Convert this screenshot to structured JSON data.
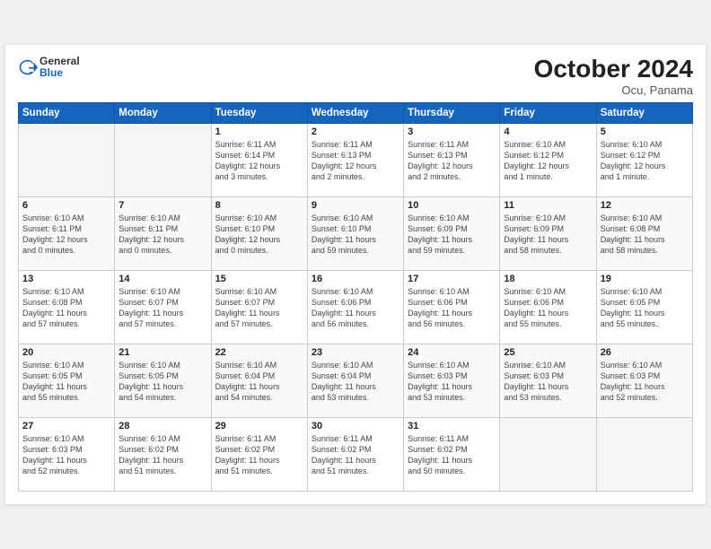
{
  "header": {
    "logo_general": "General",
    "logo_blue": "Blue",
    "month_title": "October 2024",
    "location": "Ocu, Panama"
  },
  "columns": [
    "Sunday",
    "Monday",
    "Tuesday",
    "Wednesday",
    "Thursday",
    "Friday",
    "Saturday"
  ],
  "weeks": [
    [
      {
        "day": "",
        "info": ""
      },
      {
        "day": "",
        "info": ""
      },
      {
        "day": "1",
        "info": "Sunrise: 6:11 AM\nSunset: 6:14 PM\nDaylight: 12 hours\nand 3 minutes."
      },
      {
        "day": "2",
        "info": "Sunrise: 6:11 AM\nSunset: 6:13 PM\nDaylight: 12 hours\nand 2 minutes."
      },
      {
        "day": "3",
        "info": "Sunrise: 6:11 AM\nSunset: 6:13 PM\nDaylight: 12 hours\nand 2 minutes."
      },
      {
        "day": "4",
        "info": "Sunrise: 6:10 AM\nSunset: 6:12 PM\nDaylight: 12 hours\nand 1 minute."
      },
      {
        "day": "5",
        "info": "Sunrise: 6:10 AM\nSunset: 6:12 PM\nDaylight: 12 hours\nand 1 minute."
      }
    ],
    [
      {
        "day": "6",
        "info": "Sunrise: 6:10 AM\nSunset: 6:11 PM\nDaylight: 12 hours\nand 0 minutes."
      },
      {
        "day": "7",
        "info": "Sunrise: 6:10 AM\nSunset: 6:11 PM\nDaylight: 12 hours\nand 0 minutes."
      },
      {
        "day": "8",
        "info": "Sunrise: 6:10 AM\nSunset: 6:10 PM\nDaylight: 12 hours\nand 0 minutes."
      },
      {
        "day": "9",
        "info": "Sunrise: 6:10 AM\nSunset: 6:10 PM\nDaylight: 11 hours\nand 59 minutes."
      },
      {
        "day": "10",
        "info": "Sunrise: 6:10 AM\nSunset: 6:09 PM\nDaylight: 11 hours\nand 59 minutes."
      },
      {
        "day": "11",
        "info": "Sunrise: 6:10 AM\nSunset: 6:09 PM\nDaylight: 11 hours\nand 58 minutes."
      },
      {
        "day": "12",
        "info": "Sunrise: 6:10 AM\nSunset: 6:08 PM\nDaylight: 11 hours\nand 58 minutes."
      }
    ],
    [
      {
        "day": "13",
        "info": "Sunrise: 6:10 AM\nSunset: 6:08 PM\nDaylight: 11 hours\nand 57 minutes."
      },
      {
        "day": "14",
        "info": "Sunrise: 6:10 AM\nSunset: 6:07 PM\nDaylight: 11 hours\nand 57 minutes."
      },
      {
        "day": "15",
        "info": "Sunrise: 6:10 AM\nSunset: 6:07 PM\nDaylight: 11 hours\nand 57 minutes."
      },
      {
        "day": "16",
        "info": "Sunrise: 6:10 AM\nSunset: 6:06 PM\nDaylight: 11 hours\nand 56 minutes."
      },
      {
        "day": "17",
        "info": "Sunrise: 6:10 AM\nSunset: 6:06 PM\nDaylight: 11 hours\nand 56 minutes."
      },
      {
        "day": "18",
        "info": "Sunrise: 6:10 AM\nSunset: 6:06 PM\nDaylight: 11 hours\nand 55 minutes."
      },
      {
        "day": "19",
        "info": "Sunrise: 6:10 AM\nSunset: 6:05 PM\nDaylight: 11 hours\nand 55 minutes."
      }
    ],
    [
      {
        "day": "20",
        "info": "Sunrise: 6:10 AM\nSunset: 6:05 PM\nDaylight: 11 hours\nand 55 minutes."
      },
      {
        "day": "21",
        "info": "Sunrise: 6:10 AM\nSunset: 6:05 PM\nDaylight: 11 hours\nand 54 minutes."
      },
      {
        "day": "22",
        "info": "Sunrise: 6:10 AM\nSunset: 6:04 PM\nDaylight: 11 hours\nand 54 minutes."
      },
      {
        "day": "23",
        "info": "Sunrise: 6:10 AM\nSunset: 6:04 PM\nDaylight: 11 hours\nand 53 minutes."
      },
      {
        "day": "24",
        "info": "Sunrise: 6:10 AM\nSunset: 6:03 PM\nDaylight: 11 hours\nand 53 minutes."
      },
      {
        "day": "25",
        "info": "Sunrise: 6:10 AM\nSunset: 6:03 PM\nDaylight: 11 hours\nand 53 minutes."
      },
      {
        "day": "26",
        "info": "Sunrise: 6:10 AM\nSunset: 6:03 PM\nDaylight: 11 hours\nand 52 minutes."
      }
    ],
    [
      {
        "day": "27",
        "info": "Sunrise: 6:10 AM\nSunset: 6:03 PM\nDaylight: 11 hours\nand 52 minutes."
      },
      {
        "day": "28",
        "info": "Sunrise: 6:10 AM\nSunset: 6:02 PM\nDaylight: 11 hours\nand 51 minutes."
      },
      {
        "day": "29",
        "info": "Sunrise: 6:11 AM\nSunset: 6:02 PM\nDaylight: 11 hours\nand 51 minutes."
      },
      {
        "day": "30",
        "info": "Sunrise: 6:11 AM\nSunset: 6:02 PM\nDaylight: 11 hours\nand 51 minutes."
      },
      {
        "day": "31",
        "info": "Sunrise: 6:11 AM\nSunset: 6:02 PM\nDaylight: 11 hours\nand 50 minutes."
      },
      {
        "day": "",
        "info": ""
      },
      {
        "day": "",
        "info": ""
      }
    ]
  ]
}
